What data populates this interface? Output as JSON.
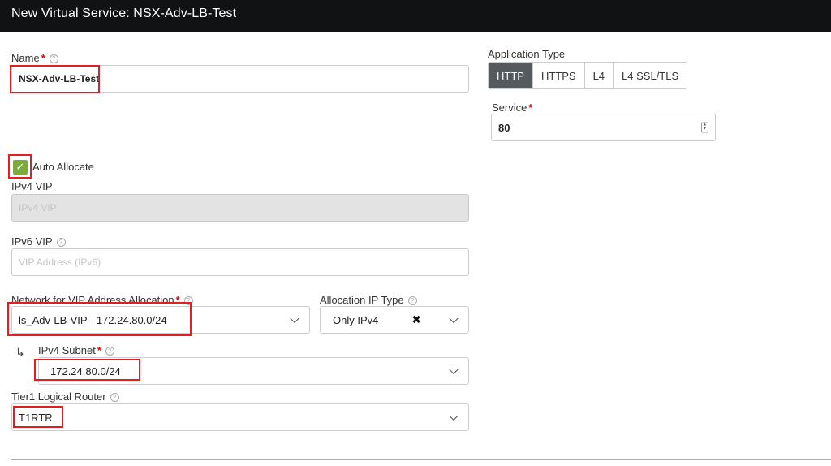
{
  "header": {
    "title": "New Virtual Service: NSX-Adv-LB-Test"
  },
  "name": {
    "label": "Name",
    "value": "NSX-Adv-LB-Test"
  },
  "application_type": {
    "label": "Application Type",
    "options": [
      "HTTP",
      "HTTPS",
      "L4",
      "L4 SSL/TLS"
    ],
    "selected": "HTTP"
  },
  "service": {
    "label": "Service",
    "value": "80"
  },
  "auto_allocate": {
    "label": "Auto Allocate",
    "checked": true
  },
  "ipv4_vip": {
    "label": "IPv4 VIP",
    "placeholder": "IPv4 VIP"
  },
  "ipv6_vip": {
    "label": "IPv6 VIP",
    "placeholder": "VIP Address (IPv6)"
  },
  "network": {
    "label": "Network for VIP Address Allocation",
    "value": "ls_Adv-LB-VIP - 172.24.80.0/24"
  },
  "allocation_ip_type": {
    "label": "Allocation IP Type",
    "value": "Only IPv4"
  },
  "ipv4_subnet": {
    "label": "IPv4 Subnet",
    "value": "172.24.80.0/24"
  },
  "tier1_router": {
    "label": "Tier1 Logical Router",
    "value": "T1RTR"
  },
  "colors": {
    "header_bg": "#111214",
    "highlight": "#e01e24",
    "checkbox": "#7bab3a",
    "segment_active": "#555a5f"
  }
}
